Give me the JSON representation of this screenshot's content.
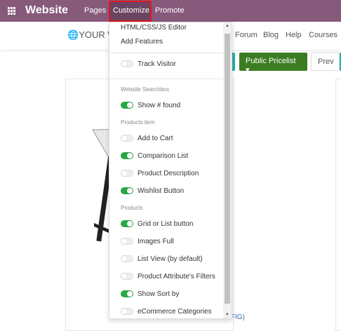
{
  "navbar": {
    "brand": "Website",
    "items": [
      "Pages",
      "Customize",
      "Promote"
    ]
  },
  "site_header": {
    "logo": "YOUR W",
    "menu": [
      "Forum",
      "Blog",
      "Help",
      "Courses"
    ]
  },
  "toolbar": {
    "pricelist": "Public Pricelist",
    "prev": "Prev"
  },
  "dropdown": {
    "links": [
      "HTML/CSS/JS Editor",
      "Add Features"
    ],
    "track_visitor": {
      "label": "Track Visitor",
      "on": false
    },
    "sections": [
      {
        "title": "Website Searchbox",
        "options": [
          {
            "label": "Show # found",
            "on": true
          }
        ]
      },
      {
        "title": "Products item",
        "options": [
          {
            "label": "Add to Cart",
            "on": false
          },
          {
            "label": "Comparison List",
            "on": true
          },
          {
            "label": "Product Description",
            "on": false
          },
          {
            "label": "Wishlist Button",
            "on": true
          }
        ]
      },
      {
        "title": "Products",
        "options": [
          {
            "label": "Grid or List button",
            "on": true
          },
          {
            "label": "Images Full",
            "on": false
          },
          {
            "label": "List View (by default)",
            "on": false
          },
          {
            "label": "Product Attribute's Filters",
            "on": false
          },
          {
            "label": "Show Sort by",
            "on": true
          },
          {
            "label": "eCommerce Categories",
            "on": false
          }
        ]
      }
    ]
  },
  "product": {
    "title_visible": "FIG)"
  }
}
